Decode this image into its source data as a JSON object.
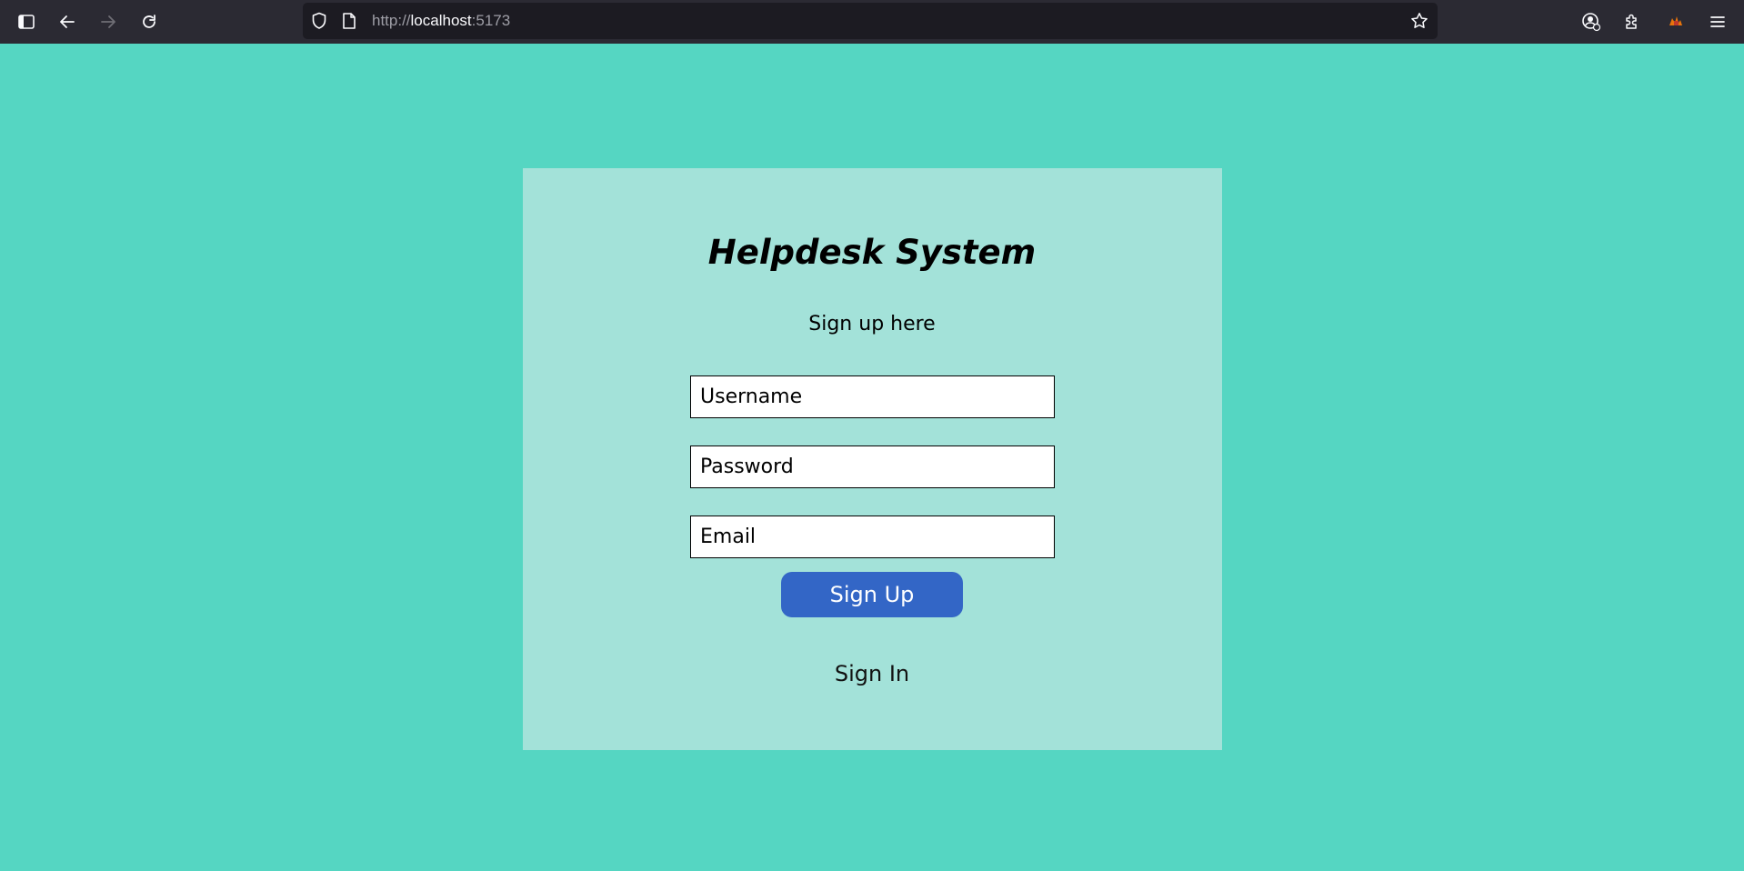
{
  "browser": {
    "url_prefix": "http://",
    "url_host": "localhost",
    "url_port": ":5173",
    "icons": {
      "sidebar": "sidebar-icon",
      "back": "back-arrow-icon",
      "forward": "forward-arrow-icon",
      "reload": "reload-icon",
      "shield": "shield-icon",
      "page": "page-icon",
      "bookmark": "star-icon",
      "account": "account-icon",
      "extensions": "puzzle-icon",
      "extension_app": "extension-app-icon",
      "menu": "hamburger-menu-icon"
    }
  },
  "page": {
    "title": "Helpdesk System",
    "subtitle": "Sign up here",
    "username_placeholder": "Username",
    "password_placeholder": "Password",
    "email_placeholder": "Email",
    "signup_label": "Sign Up",
    "signin_label": "Sign In"
  },
  "colors": {
    "background": "#55d6c2",
    "card": "#a3e2d9",
    "button": "#3366c6",
    "chrome": "#2b2a33",
    "urlbar": "#1c1b22"
  }
}
